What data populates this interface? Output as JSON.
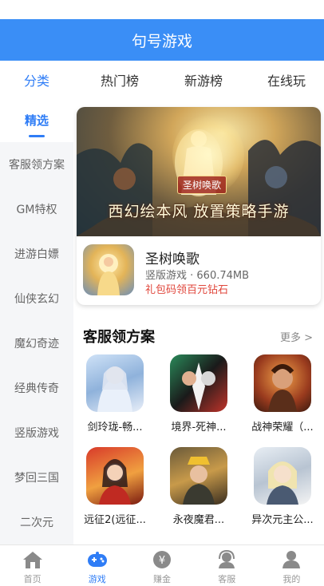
{
  "header": {
    "title": "句号游戏"
  },
  "tabs": [
    {
      "label": "分类",
      "active": true
    },
    {
      "label": "热门榜",
      "active": false
    },
    {
      "label": "新游榜",
      "active": false
    },
    {
      "label": "在线玩",
      "active": false
    }
  ],
  "sidebar": {
    "items": [
      {
        "label": "精选",
        "active": true
      },
      {
        "label": "客服领方案",
        "active": false
      },
      {
        "label": "GM特权",
        "active": false
      },
      {
        "label": "进游白嫖",
        "active": false
      },
      {
        "label": "仙侠玄幻",
        "active": false
      },
      {
        "label": "魔幻奇迹",
        "active": false
      },
      {
        "label": "经典传奇",
        "active": false
      },
      {
        "label": "竖版游戏",
        "active": false
      },
      {
        "label": "梦回三国",
        "active": false
      },
      {
        "label": "二次元",
        "active": false
      }
    ]
  },
  "featured": {
    "banner_logo": "圣树唤歌",
    "banner_title": "西幻绘本风 放置策略手游",
    "name": "圣树唤歌",
    "meta": "竖版游戏 · 660.74MB",
    "gift": "礼包码领百元钻石"
  },
  "section": {
    "title": "客服领方案",
    "more": "更多 >",
    "games": [
      {
        "name": "剑玲珑-畅..."
      },
      {
        "name": "境界-死神..."
      },
      {
        "name": "战神荣耀（..."
      },
      {
        "name": "远征2(远征..."
      },
      {
        "name": "永夜魔君..."
      },
      {
        "name": "异次元主公..."
      }
    ]
  },
  "bottom_nav": [
    {
      "label": "首页",
      "icon": "home-icon",
      "active": false
    },
    {
      "label": "游戏",
      "icon": "gamepad-icon",
      "active": true
    },
    {
      "label": "赚金",
      "icon": "yen-coin-icon",
      "active": false
    },
    {
      "label": "客服",
      "icon": "headset-icon",
      "active": false
    },
    {
      "label": "我的",
      "icon": "user-icon",
      "active": false
    }
  ],
  "colors": {
    "primary": "#3a8ef6",
    "accent_text": "#2f7df6",
    "gift_red": "#e0463b"
  }
}
